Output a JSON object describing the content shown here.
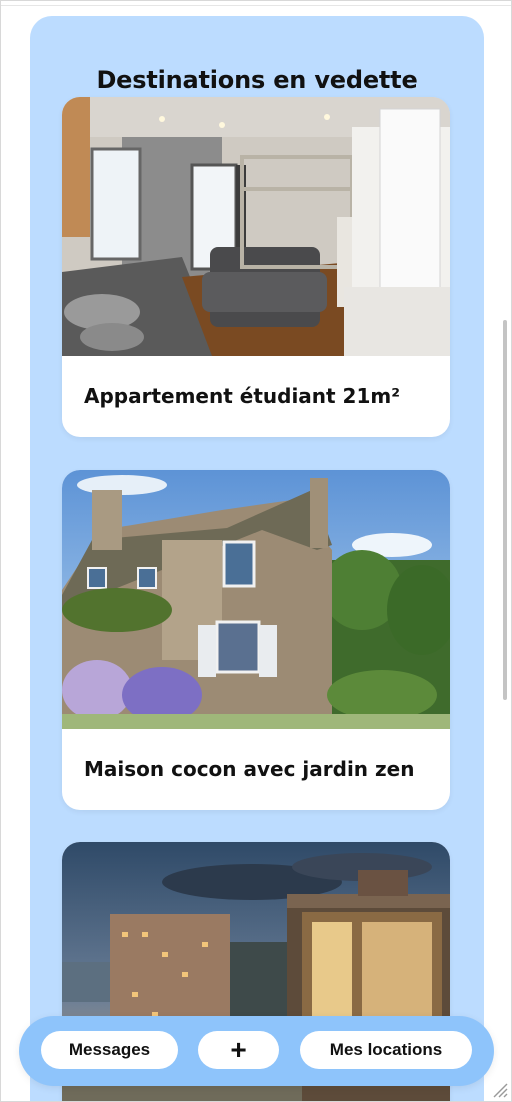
{
  "section": {
    "title": "Destinations en vedette"
  },
  "listings": [
    {
      "title": "Appartement étudiant 21m²"
    },
    {
      "title": "Maison cocon avec jardin zen"
    },
    {
      "title": ""
    }
  ],
  "bottom_nav": {
    "messages_label": "Messages",
    "add_label": "+",
    "locations_label": "Mes locations"
  },
  "colors": {
    "panel_bg": "#bcdcff",
    "nav_bg": "#8ec4fb",
    "card_bg": "#ffffff"
  }
}
